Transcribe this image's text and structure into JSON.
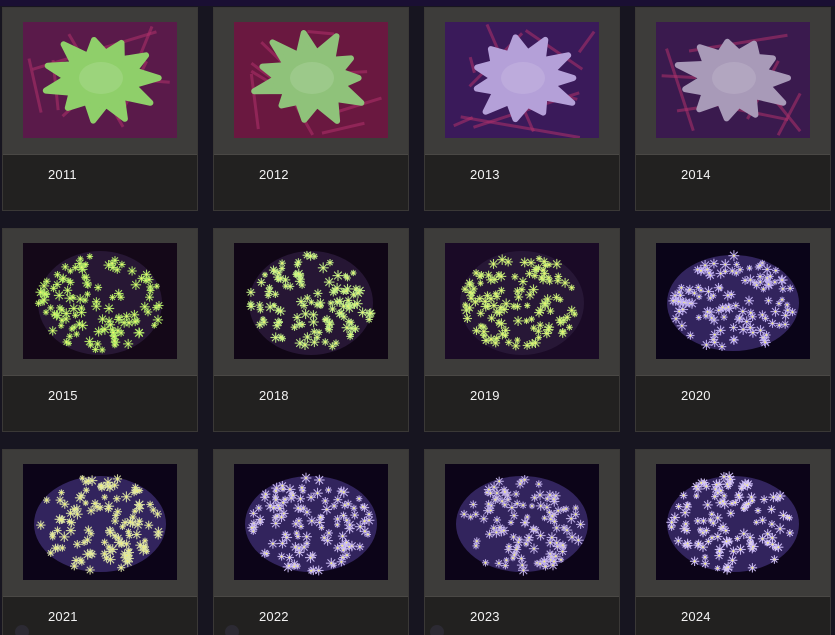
{
  "gallery": {
    "items": [
      {
        "year": "2011",
        "style": "leather",
        "color": "#8fcf6a",
        "bg": "#5a1a4a"
      },
      {
        "year": "2012",
        "style": "leather",
        "color": "#8fc27a",
        "bg": "#6a1840"
      },
      {
        "year": "2013",
        "style": "leather",
        "color": "#b4a0d8",
        "bg": "#3a1a5a"
      },
      {
        "year": "2014",
        "style": "leather",
        "color": "#a89ab8",
        "bg": "#3a1a4e"
      },
      {
        "year": "2015",
        "style": "polyps-green",
        "color": "#b6f06a",
        "bg": "#140818"
      },
      {
        "year": "2018",
        "style": "polyps-green",
        "color": "#c6f58a",
        "bg": "#100616"
      },
      {
        "year": "2019",
        "style": "polyps-green",
        "color": "#c8f27a",
        "bg": "#1a0a26"
      },
      {
        "year": "2020",
        "style": "polyps-purple",
        "color": "#c8b8f8",
        "bg": "#0a0418"
      },
      {
        "year": "2021",
        "style": "polyps-purple",
        "color": "#e0e8a8",
        "bg": "#0c0418"
      },
      {
        "year": "2022",
        "style": "polyps-purple",
        "color": "#d0c0f8",
        "bg": "#0c0418"
      },
      {
        "year": "2023",
        "style": "polyps-purple",
        "color": "#c8b8f0",
        "bg": "#0c0418"
      },
      {
        "year": "2024",
        "style": "polyps-purple",
        "color": "#d8c8ff",
        "bg": "#0c0418"
      }
    ]
  }
}
